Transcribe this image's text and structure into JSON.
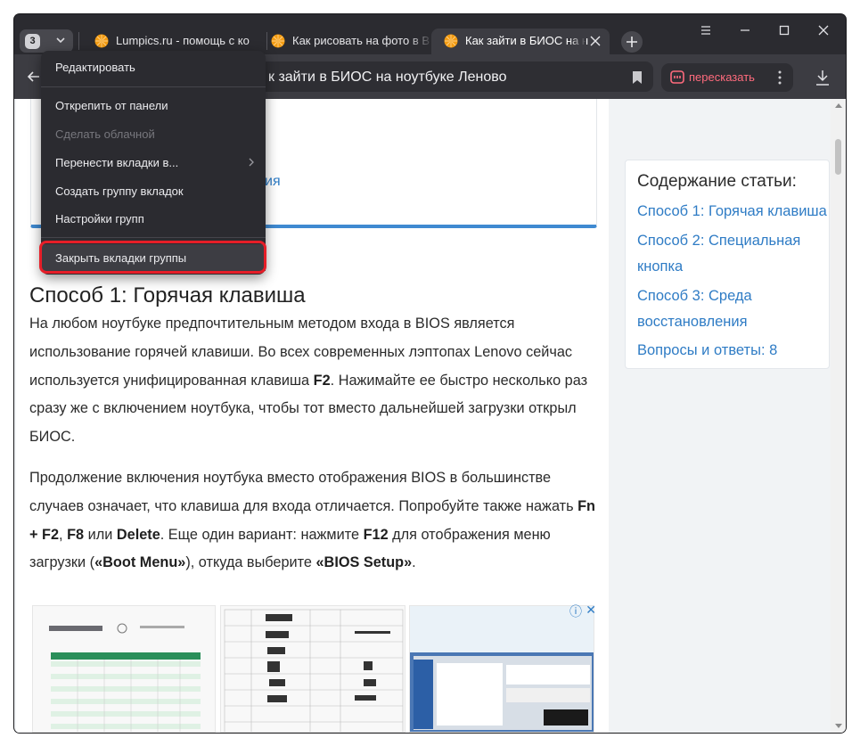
{
  "tabs": {
    "group_count": "3",
    "items": [
      {
        "title": "Lumpics.ru - помощь с ко",
        "active": false
      },
      {
        "title": "Как рисовать на фото в В",
        "active": false
      },
      {
        "title": "Как зайти в БИОС на н",
        "active": true
      }
    ]
  },
  "toolbar": {
    "page_title": "к зайти в БИОС на ноутбуке Леново",
    "retell_label": "пересказать"
  },
  "context_menu": {
    "items": [
      {
        "label": "Редактировать",
        "enabled": true
      },
      {
        "label": "Открепить от панели",
        "enabled": true
      },
      {
        "label": "Сделать облачной",
        "enabled": false
      },
      {
        "label": "Перенести вкладки в...",
        "enabled": true,
        "submenu": true
      },
      {
        "label": "Создать группу вкладок",
        "enabled": true
      },
      {
        "label": "Настройки групп",
        "enabled": true
      },
      {
        "label": "Закрыть вкладки группы",
        "enabled": true,
        "highlighted": true
      }
    ]
  },
  "article": {
    "toc_fragment": "ия",
    "heading": "Способ 1: Горячая клавиша",
    "para1": [
      {
        "t": "На любом ноутбуке предпочтительным методом входа в BIOS является использование горячей клавиши. Во всех современных лэптопах Lenovo сейчас используется унифицированная клавиша ",
        "b": false
      },
      {
        "t": "F2",
        "b": true
      },
      {
        "t": ". Нажимайте ее быстро несколько раз сразу же с включением ноутбука, чтобы тот вместо дальнейшей загрузки открыл БИОС.",
        "b": false
      }
    ],
    "para2": [
      {
        "t": "Продолжение включения ноутбука вместо отображения BIOS в большинстве случаев означает, что клавиша для входа отличается. Попробуйте также нажать ",
        "b": false
      },
      {
        "t": "Fn + F2",
        "b": true
      },
      {
        "t": ", ",
        "b": false
      },
      {
        "t": "F8",
        "b": true
      },
      {
        "t": " или ",
        "b": false
      },
      {
        "t": "Delete",
        "b": true
      },
      {
        "t": ". Еще один вариант: нажмите ",
        "b": false
      },
      {
        "t": "F12",
        "b": true
      },
      {
        "t": " для отображения меню загрузки (",
        "b": false
      },
      {
        "t": "«Boot Menu»",
        "b": true
      },
      {
        "t": "), откуда выберите ",
        "b": false
      },
      {
        "t": "«BIOS Setup»",
        "b": true
      },
      {
        "t": ".",
        "b": false
      }
    ]
  },
  "sidebar": {
    "toc_title": "Содержание статьи:",
    "links": [
      "Способ 1: Горячая клавиша",
      "Способ 2: Специальная",
      "кнопка",
      "Способ 3: Среда",
      "восстановления",
      "Вопросы и ответы: 8"
    ]
  },
  "colors": {
    "chrome": "#2b2b30",
    "link": "#2f7cc5",
    "highlight_outline": "#e61e28",
    "retell_accent": "#ff6b7d"
  }
}
